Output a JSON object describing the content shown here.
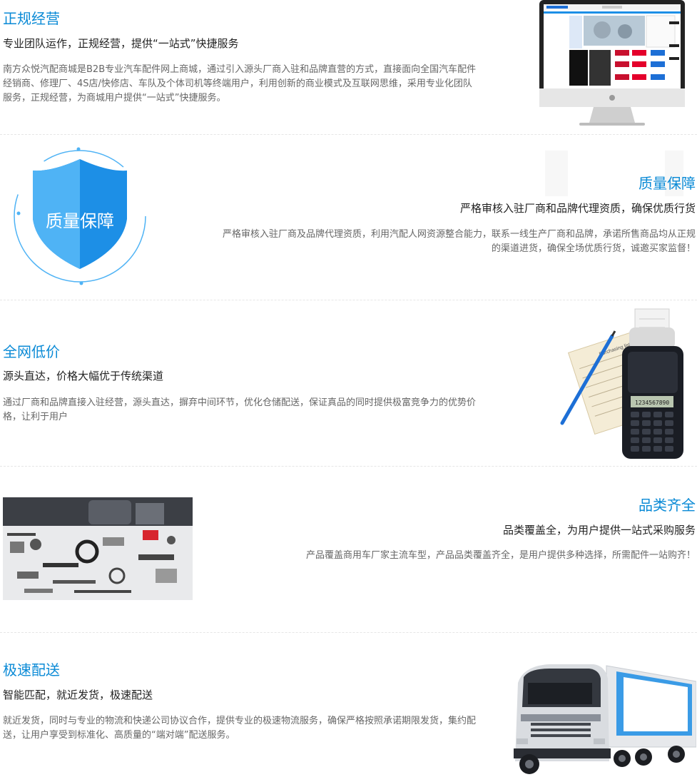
{
  "sections": [
    {
      "title": "正规经营",
      "subtitle": "专业团队运作，正规经营，提供“一站式”快捷服务",
      "desc": "南方众悦汽配商城是B2B专业汽车配件网上商城，通过引入源头厂商入驻和品牌直营的方式，直接面向全国汽车配件经销商、修理厂、4S店/快修店、车队及个体司机等终端用户，利用创新的商业模式及互联网思维，采用专业化团队服务，正规经营，为商城用户提供“一站式”快捷服务。"
    },
    {
      "title": "质量保障",
      "subtitle": "严格审核入驻厂商和品牌代理资质，确保优质行货",
      "desc": "严格审核入驻厂商及品牌代理资质，利用汽配人网资源整合能力，联系一线生产厂商和品牌，承诺所售商品均从正规的渠道进货，确保全场优质行货，诚邀买家监督！",
      "badge_text": "质量保障"
    },
    {
      "title": "全网低价",
      "subtitle": "源头直达，价格大幅优于传统渠道",
      "desc": "通过厂商和品牌直接入驻经营，源头直达，摒弃中间环节，优化仓储配送，保证真品的同时提供极富竞争力的优势价格，让利于用户",
      "calc_display": "1234567890",
      "receipt_text": "Purchasing list"
    },
    {
      "title": "品类齐全",
      "subtitle": "品类覆盖全，为用户提供一站式采购服务",
      "desc": "产品覆盖商用车厂家主流车型，产品品类覆盖齐全，是用户提供多种选择，所需配件一站购齐！"
    },
    {
      "title": "极速配送",
      "subtitle": "智能匹配，就近发货，极速配送",
      "desc": "就近发货，同时与专业的物流和快递公司协议合作，提供专业的极速物流服务，确保严格按照承诺期限发货，集约配送，让用户享受到标准化、高质量的“端对端”配送服务。"
    }
  ],
  "colors": {
    "accent": "#0a8ad6",
    "shield_light": "#4fb3f5",
    "shield_dark": "#1d8fe6"
  },
  "icons": [
    "imac-monitor-illustration",
    "quality-shield-icon",
    "calculator-receipt-illustration",
    "auto-parts-photo",
    "delivery-truck-illustration"
  ]
}
